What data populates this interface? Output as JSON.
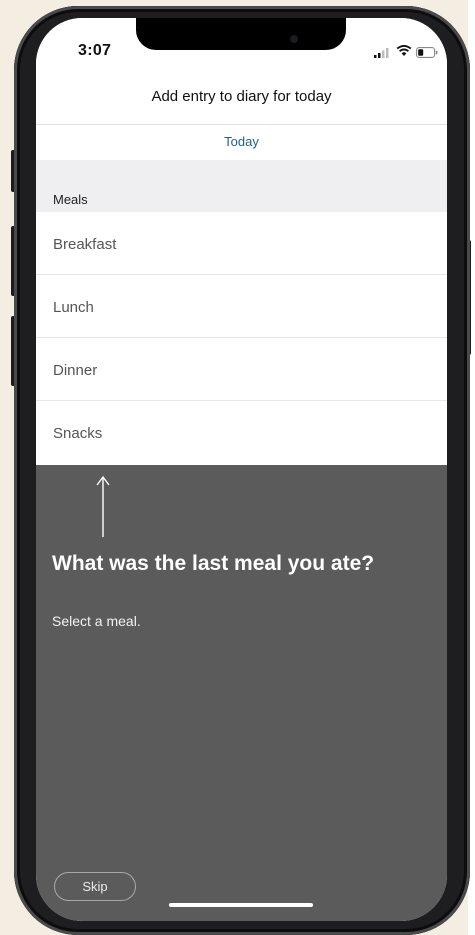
{
  "status_bar": {
    "time": "3:07",
    "signal_icon": "signal-icon",
    "wifi_icon": "wifi-icon",
    "battery_icon": "battery-icon"
  },
  "nav": {
    "title": "Add entry to diary for today",
    "date_tab": "Today"
  },
  "section": {
    "label": "Meals"
  },
  "meals": [
    "Breakfast",
    "Lunch",
    "Dinner",
    "Snacks"
  ],
  "prompt": {
    "title": "What was the last meal you ate?",
    "subtitle": "Select a meal.",
    "skip_label": "Skip",
    "arrow_icon": "arrow-up-icon"
  },
  "colors": {
    "accent": "#1d5f97",
    "overlay": "#5b5b5b",
    "section_bg": "#efeff2",
    "page_bg": "#f4ede1"
  }
}
